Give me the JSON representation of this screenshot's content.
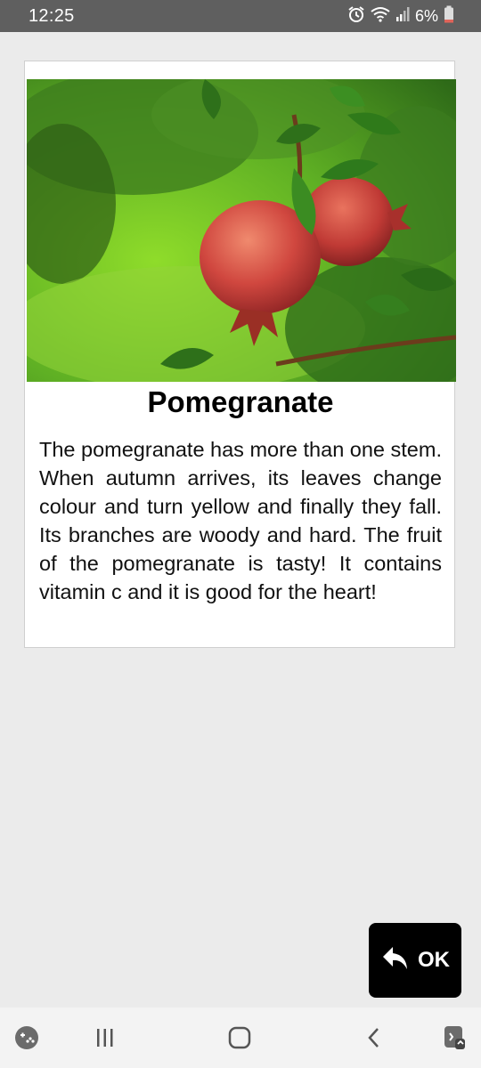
{
  "status_bar": {
    "time": "12:25",
    "battery_percent": "6%",
    "icons": [
      "alarm-icon",
      "wifi-icon",
      "signal-icon",
      "battery-icon"
    ]
  },
  "card": {
    "image_alt": "pomegranate-photo",
    "title": "Pomegranate",
    "description": "The pomegranate has more than one stem. When autumn arrives, its leaves change colour and turn yellow and finally they fall. Its branches are woody and hard. The fruit of the pomegranate is tasty! It contains vitamin c and it is good for the heart!"
  },
  "ok_button": {
    "label": "OK",
    "icon": "reply-arrow-icon"
  },
  "nav_bar": {
    "items": [
      "game-launcher-icon",
      "recent-apps-icon",
      "home-icon",
      "back-icon",
      "assistant-icon"
    ]
  },
  "colors": {
    "status_bar": "#5f5f5f",
    "background": "#ebebeb",
    "card": "#ffffff",
    "button": "#000000",
    "fruit": "#c94b43",
    "foliage": "#3f8f26"
  }
}
